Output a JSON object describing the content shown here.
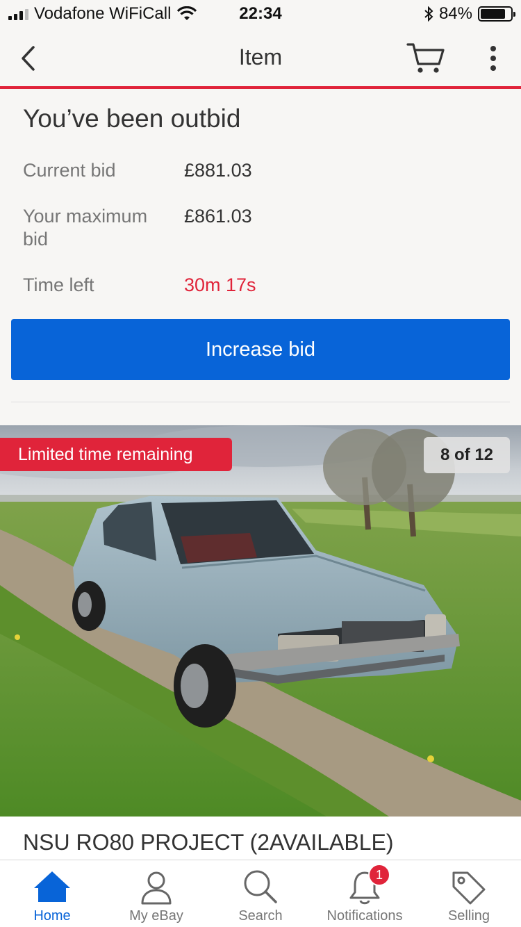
{
  "status_bar": {
    "carrier": "Vodafone WiFiCall",
    "time": "22:34",
    "battery": "84%",
    "battery_level": 0.84
  },
  "nav": {
    "title": "Item"
  },
  "outbid": {
    "title": "You’ve been outbid",
    "rows": [
      {
        "label": "Current bid",
        "value": "£881.03"
      },
      {
        "label": "Your maximum bid",
        "value": "£861.03"
      },
      {
        "label": "Time left",
        "value": "30m 17s"
      }
    ],
    "button_label": "Increase bid"
  },
  "gallery": {
    "badge": "Limited time remaining",
    "counter": "8 of 12"
  },
  "item": {
    "title": "NSU RO80 PROJECT (2AVAILABLE)"
  },
  "tab_bar": {
    "tabs": [
      {
        "label": "Home",
        "icon": "home-icon",
        "active": true
      },
      {
        "label": "My eBay",
        "icon": "user-icon"
      },
      {
        "label": "Search",
        "icon": "search-icon"
      },
      {
        "label": "Notifications",
        "icon": "bell-icon",
        "badge": "1"
      },
      {
        "label": "Selling",
        "icon": "tag-icon"
      }
    ]
  },
  "colors": {
    "accent_red": "#e0243a",
    "primary_blue": "#0864d8",
    "background": "#f7f6f4"
  }
}
